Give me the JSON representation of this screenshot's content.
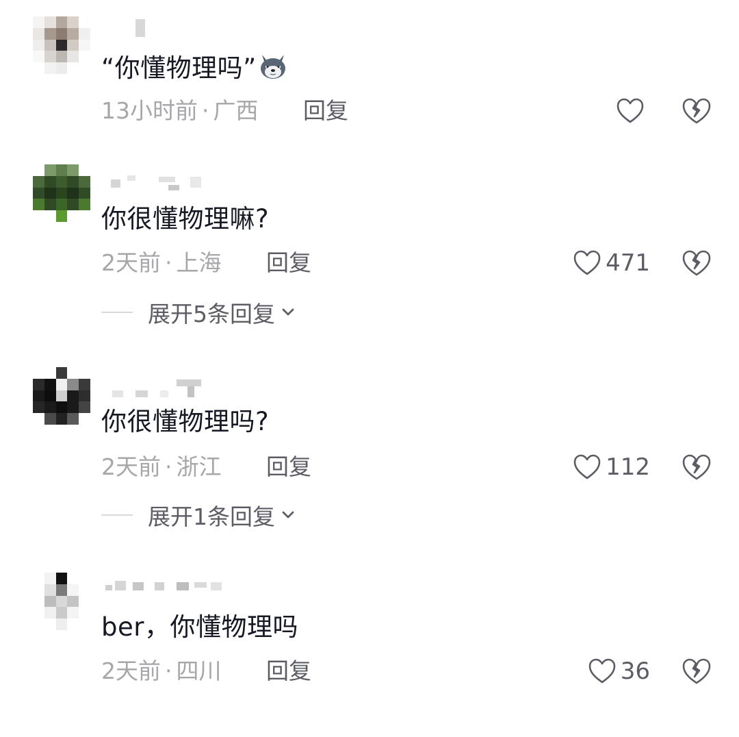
{
  "comments": [
    {
      "text": "“你懂物理吗”",
      "time": "13小时前",
      "location": "广西",
      "reply_label": "回复",
      "like_count": "",
      "has_emoji": "wolf-emoji-icon"
    },
    {
      "text": "你很懂物理嘛?",
      "time": "2天前",
      "location": "上海",
      "reply_label": "回复",
      "like_count": "471",
      "expand_label": "展开5条回复"
    },
    {
      "text": "你很懂物理吗?",
      "time": "2天前",
      "location": "浙江",
      "reply_label": "回复",
      "like_count": "112",
      "expand_label": "展开1条回复"
    },
    {
      "text": "ber，你懂物理吗",
      "time": "2天前",
      "location": "四川",
      "reply_label": "回复",
      "like_count": "36"
    }
  ],
  "separator": "·",
  "colors": {
    "text_primary": "#161823",
    "text_meta": "#a6a6ab",
    "text_action": "#5b5c64",
    "icon_stroke": "#5b5c64"
  },
  "icons": [
    "heart-outline-icon",
    "broken-heart-icon",
    "chevron-down-icon",
    "wolf-emoji-icon"
  ]
}
